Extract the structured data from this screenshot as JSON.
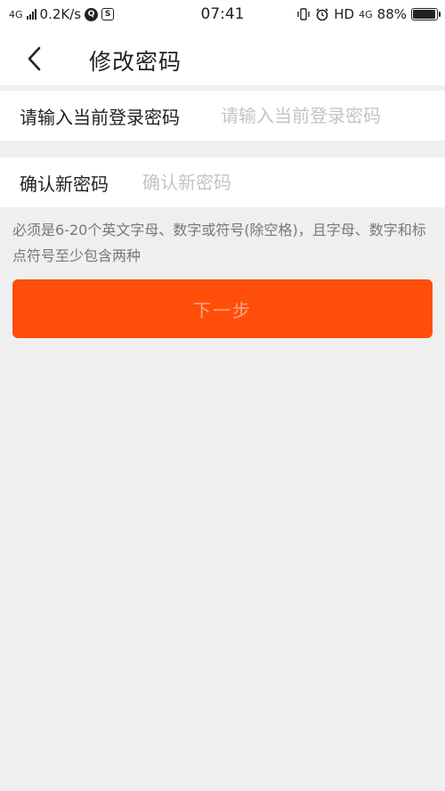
{
  "status_bar": {
    "network": "4G",
    "speed": "0.2K/s",
    "app_icon_1": "Q",
    "app_icon_2": "S",
    "time": "07:41",
    "hd": "HD",
    "network_right": "4G",
    "battery": "88%",
    "icons": [
      "signal-icon",
      "q-app-icon",
      "s-app-icon",
      "vibrate-icon",
      "alarm-icon",
      "battery-icon"
    ]
  },
  "nav": {
    "back_icon": "chevron-left-icon",
    "title": "修改密码"
  },
  "form": {
    "current_password": {
      "label": "请输入当前登录密码",
      "placeholder": "请输入当前登录密码"
    },
    "confirm_password": {
      "label": "确认新密码",
      "placeholder": "确认新密码"
    },
    "hint": "必须是6-20个英文字母、数字或符号(除空格)，且字母、数字和标点符号至少包含两种"
  },
  "next_button": {
    "label": "下一步"
  },
  "colors": {
    "accent": "#ff4e0a",
    "button_text": "#ffa787",
    "background": "#efefef",
    "placeholder": "#c4c4c4"
  }
}
